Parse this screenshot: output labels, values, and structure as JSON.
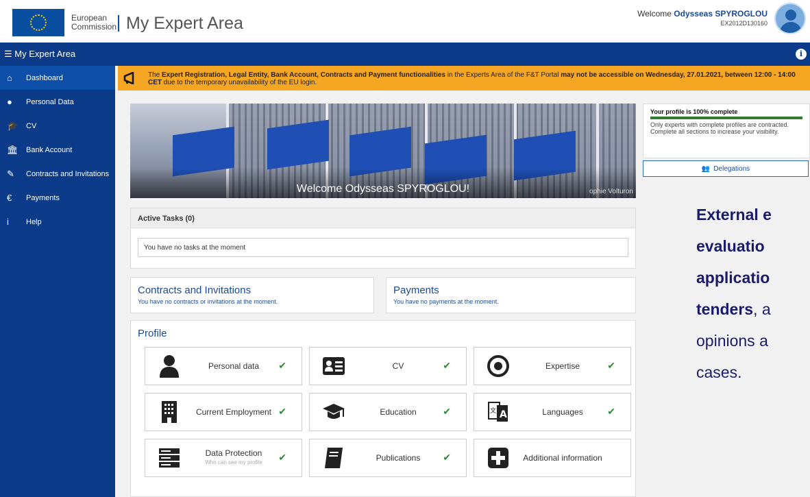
{
  "header": {
    "logo_line1": "European",
    "logo_line2": "Commission",
    "title": "My Expert Area",
    "welcome_prefix": "Welcome",
    "user_name": "Odysseas SPYROGLOU",
    "user_id": "EX2012D130160"
  },
  "topbar": {
    "menu_label": "My Expert Area",
    "info_icon": "i"
  },
  "sidebar": {
    "items": [
      {
        "label": "Dashboard",
        "icon": "home-icon",
        "glyph": "⌂"
      },
      {
        "label": "Personal Data",
        "icon": "user-icon",
        "glyph": "●"
      },
      {
        "label": "CV",
        "icon": "graduation-cap-icon",
        "glyph": "🎓"
      },
      {
        "label": "Bank Account",
        "icon": "bank-icon",
        "glyph": "🏛"
      },
      {
        "label": "Contracts and Invitations",
        "icon": "edit-icon",
        "glyph": "✎"
      },
      {
        "label": "Payments",
        "icon": "euro-icon",
        "glyph": "€"
      },
      {
        "label": "Help",
        "icon": "info-icon",
        "glyph": "i"
      }
    ]
  },
  "alert": {
    "t1": "The ",
    "b1": "Expert Registration, Legal Entity, Bank Account, Contracts and Payment functionalities",
    "t2": " in the Experts Area of the F&T Portal ",
    "b2": "may not be accessible on Wednesday, 27.01.2021, between 12:00 - 14:00 CET",
    "t3": " due to the temporary unavailability of the EU login."
  },
  "hero": {
    "welcome": "Welcome Odysseas SPYROGLOU!",
    "credit": "ophie Volturon"
  },
  "profile_status": {
    "title": "Your profile is 100% complete",
    "progress": 1.0,
    "text": "Only experts with complete profiles are contracted. Complete all sections to increase your visibility."
  },
  "delegations_label": "Delegations",
  "tasks": {
    "title": "Active Tasks (0)",
    "empty": "You have no tasks at the moment"
  },
  "contracts": {
    "title": "Contracts and Invitations",
    "sub": "You have no contracts or invitations at the moment."
  },
  "payments": {
    "title": "Payments",
    "sub": "You have no payments at the moment."
  },
  "profile": {
    "title": "Profile",
    "tiles": [
      {
        "label": "Personal data",
        "sub": "",
        "icon": "user-icon",
        "complete": true
      },
      {
        "label": "CV",
        "sub": "",
        "icon": "id-card-icon",
        "complete": true
      },
      {
        "label": "Expertise",
        "sub": "",
        "icon": "target-icon",
        "complete": true
      },
      {
        "label": "Current Employment",
        "sub": "",
        "icon": "building-icon",
        "complete": true
      },
      {
        "label": "Education",
        "sub": "",
        "icon": "graduation-cap-icon",
        "complete": true
      },
      {
        "label": "Languages",
        "sub": "",
        "icon": "language-icon",
        "complete": true
      },
      {
        "label": "Data Protection",
        "sub": "Who can see my profile",
        "icon": "server-icon",
        "complete": true
      },
      {
        "label": "Publications",
        "sub": "",
        "icon": "book-icon",
        "complete": true
      },
      {
        "label": "Additional information",
        "sub": "",
        "icon": "plus-square-icon",
        "complete": false
      }
    ]
  },
  "overlay": {
    "line1": "External e",
    "line2": "evaluatio",
    "line3": "applicatio",
    "line4_bold": "tenders",
    "line4_rest": ", a",
    "line5": "opinions a",
    "line6": "cases."
  },
  "check_glyph": "✔"
}
